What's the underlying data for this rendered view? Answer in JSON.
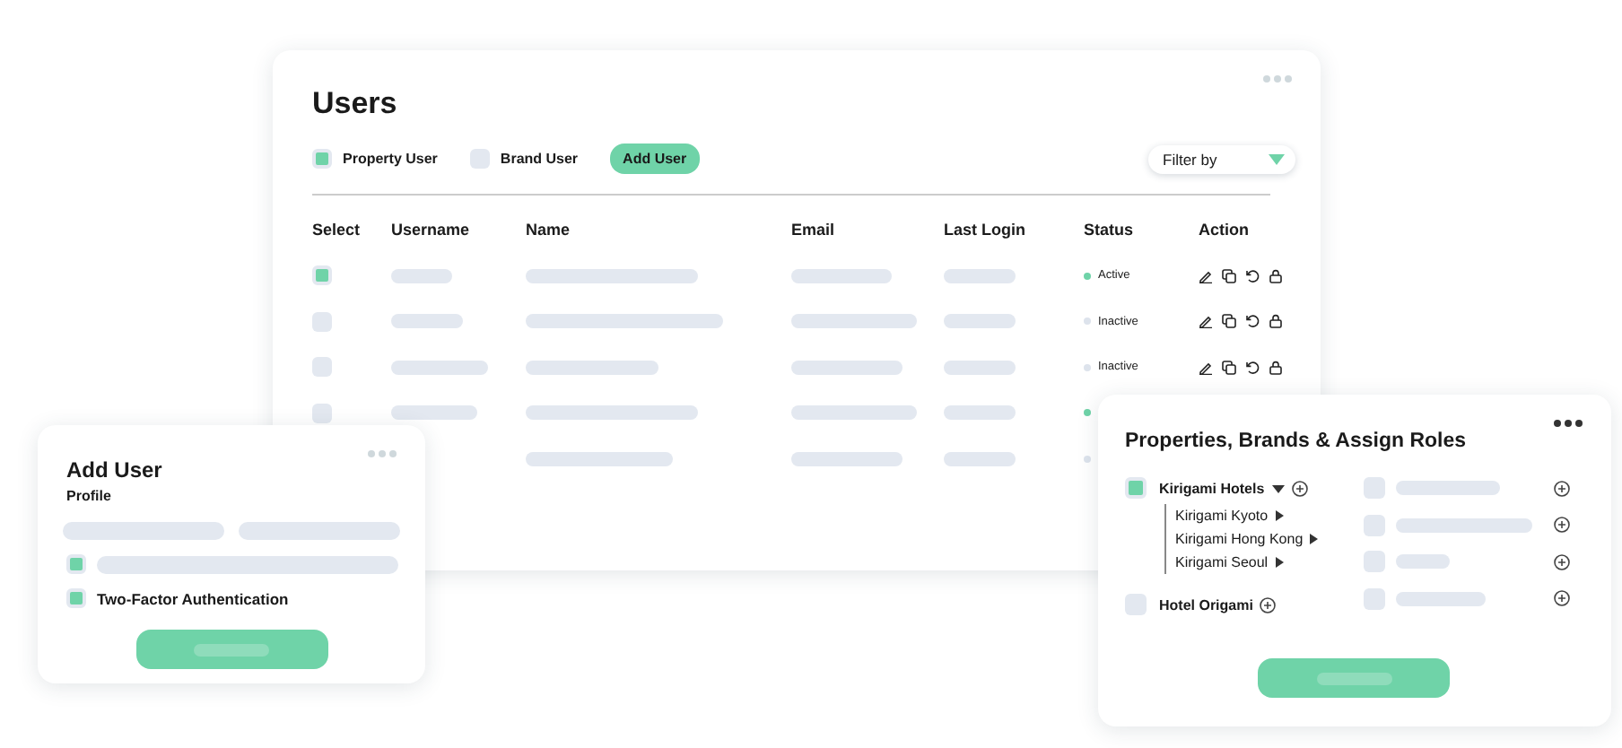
{
  "users_card": {
    "title": "Users",
    "filters": [
      {
        "label": "Property User",
        "checked": true
      },
      {
        "label": "Brand User",
        "checked": false
      }
    ],
    "add_button": "Add User",
    "filter_dropdown": {
      "label": "Filter by"
    },
    "table": {
      "columns": [
        "Select",
        "Username",
        "Name",
        "Email",
        "Last Login",
        "Status",
        "Action"
      ],
      "rows": [
        {
          "checked": true,
          "active": true,
          "status": "Active",
          "actions": true
        },
        {
          "checked": false,
          "active": false,
          "status": "Inactive",
          "actions": true
        },
        {
          "checked": false,
          "active": false,
          "status": "Inactive",
          "actions": true
        },
        {
          "checked": false,
          "active": true,
          "actions": false
        },
        {
          "active": false,
          "actions": false
        }
      ]
    }
  },
  "add_user_card": {
    "title": "Add User",
    "subtitle": "Profile",
    "options": [
      {
        "kind": "placeholder",
        "checked": true
      },
      {
        "kind": "label",
        "label": "Two-Factor Authentication",
        "checked": true
      }
    ]
  },
  "assign_card": {
    "title": "Properties, Brands & Assign Roles",
    "properties": [
      {
        "name": "Kirigami Hotels",
        "checked": true,
        "expanded": true,
        "children": [
          {
            "name": "Kirigami Kyoto",
            "expanded": false
          },
          {
            "name": "Kirigami Hong Kong",
            "expanded": false
          },
          {
            "name": "Kirigami Seoul",
            "expanded": false
          }
        ]
      },
      {
        "name": "Hotel Origami",
        "checked": false
      }
    ],
    "roles": [
      {
        "checked": false
      },
      {
        "checked": false
      },
      {
        "checked": false
      },
      {
        "checked": false
      }
    ]
  }
}
